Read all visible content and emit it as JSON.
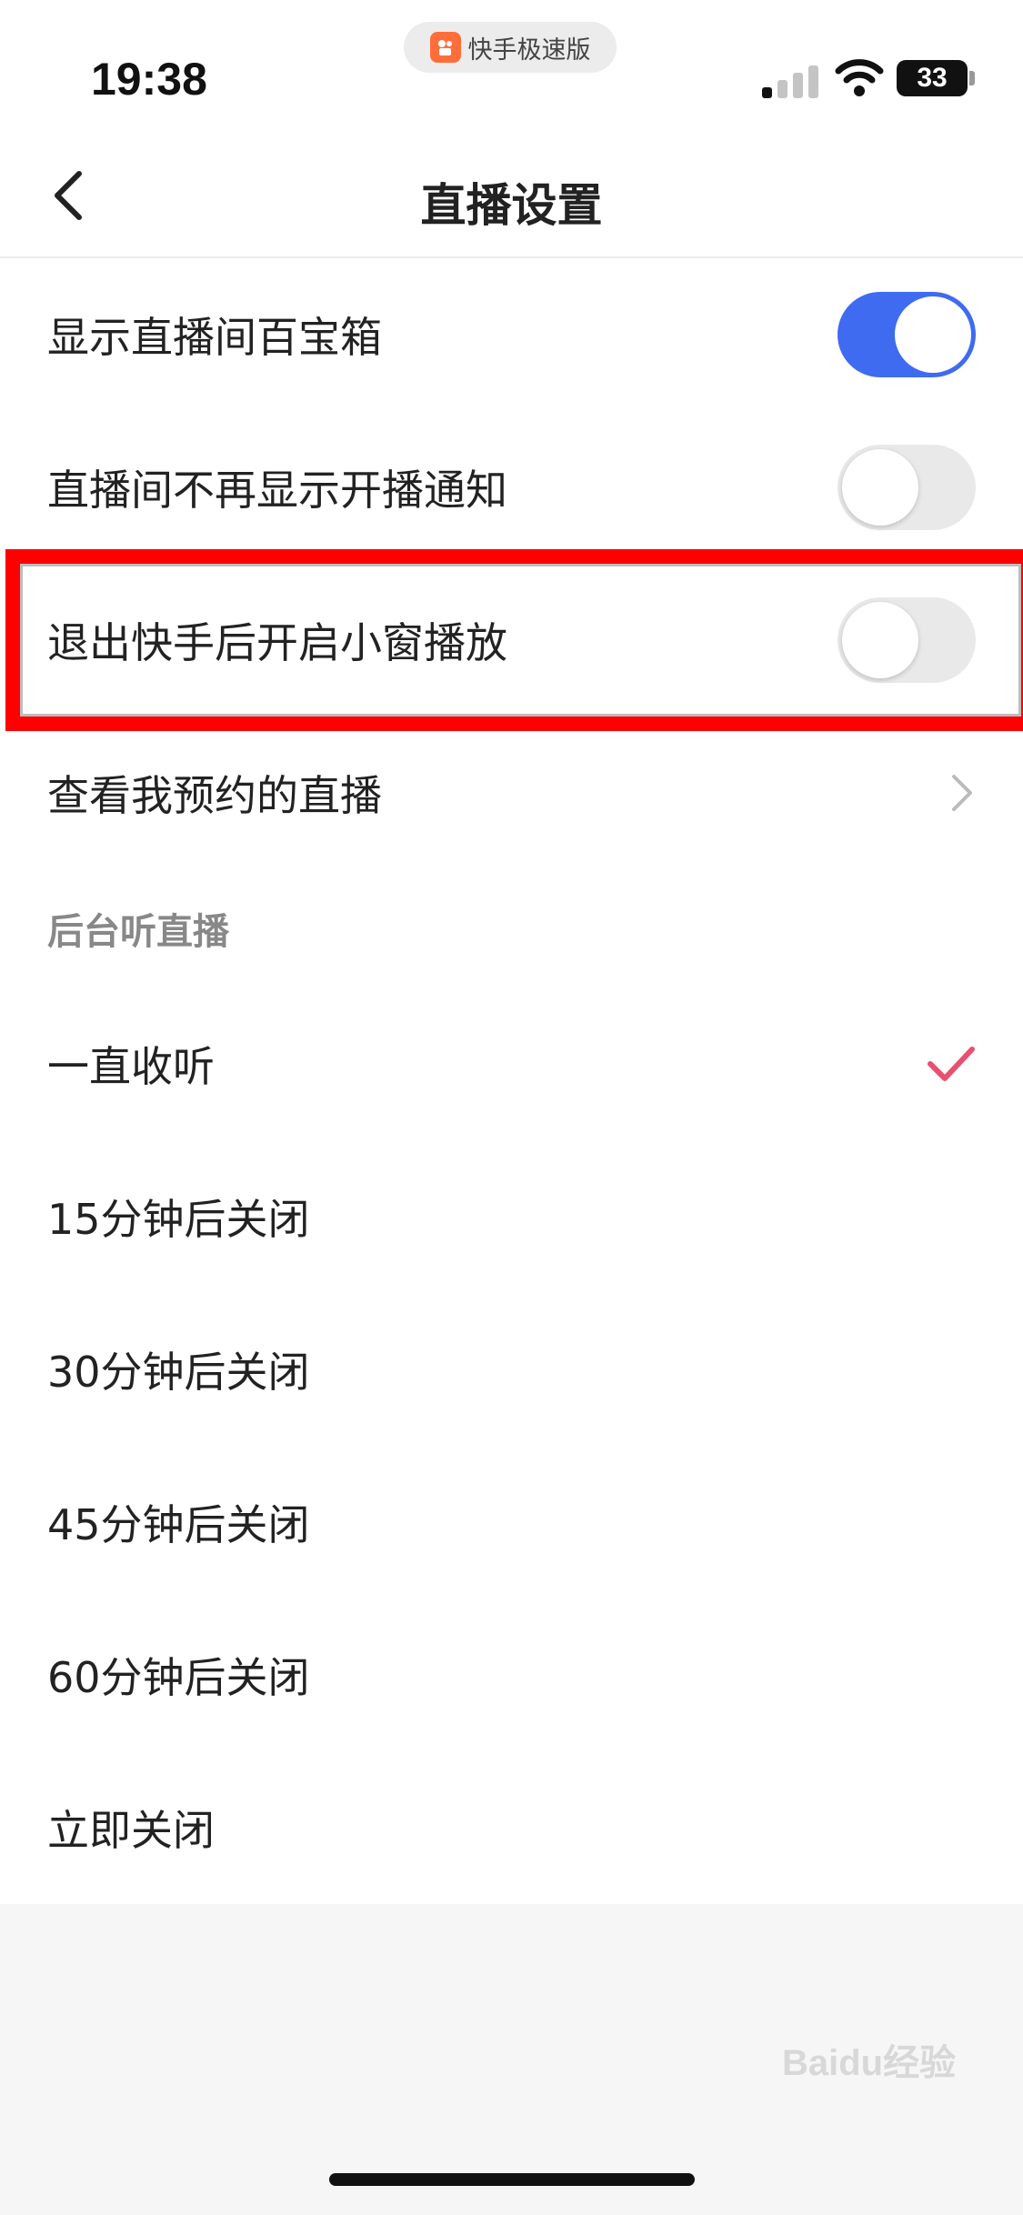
{
  "status_bar": {
    "time": "19:38",
    "app_badge": "快手极速版",
    "battery": "33"
  },
  "nav": {
    "title": "直播设置"
  },
  "toggles": [
    {
      "label": "显示直播间百宝箱",
      "on": true
    },
    {
      "label": "直播间不再显示开播通知",
      "on": false
    },
    {
      "label": "退出快手后开启小窗播放",
      "on": false
    }
  ],
  "link_row": {
    "label": "查看我预约的直播"
  },
  "background_listen": {
    "header": "后台听直播",
    "options": [
      {
        "label": "一直收听",
        "selected": true
      },
      {
        "label": "15分钟后关闭",
        "selected": false
      },
      {
        "label": "30分钟后关闭",
        "selected": false
      },
      {
        "label": "45分钟后关闭",
        "selected": false
      },
      {
        "label": "60分钟后关闭",
        "selected": false
      },
      {
        "label": "立即关闭",
        "selected": false
      }
    ]
  },
  "colors": {
    "toggle_on": "#3e6bf0",
    "check": "#e94f6e",
    "highlight": "#ff0000"
  },
  "watermark": "Baidu经验"
}
